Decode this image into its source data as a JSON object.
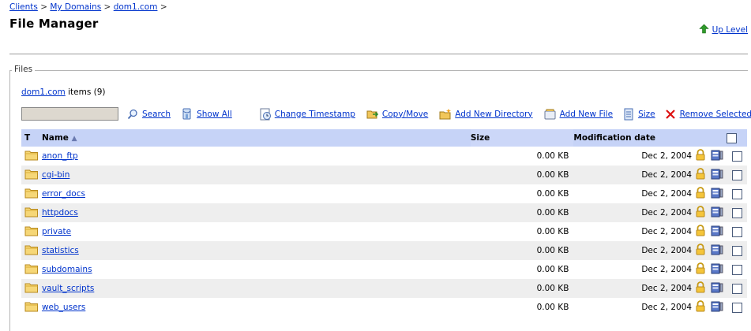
{
  "breadcrumb": {
    "items": [
      "Clients",
      "My Domains",
      "dom1.com"
    ],
    "separator": ">"
  },
  "page": {
    "title": "File Manager",
    "up_level_label": "Up Level"
  },
  "files": {
    "section_label": "Files",
    "domain_link": "dom1.com",
    "items_text": "items (9)"
  },
  "toolbar": {
    "search_value": "",
    "search_label": "Search",
    "show_all_label": "Show All",
    "change_timestamp_label": "Change Timestamp",
    "copy_move_label": "Copy/Move",
    "add_new_directory_label": "Add New Directory",
    "add_new_file_label": "Add New File",
    "size_label": "Size",
    "remove_selected_label": "Remove Selected"
  },
  "table": {
    "columns": {
      "type": "T",
      "name": "Name",
      "name_sort_indicator": "▲",
      "size": "Size",
      "modified": "Modification date"
    },
    "rows": [
      {
        "name": "anon_ftp",
        "size": "0.00 KB",
        "date": "Dec 2, 2004"
      },
      {
        "name": "cgi-bin",
        "size": "0.00 KB",
        "date": "Dec 2, 2004"
      },
      {
        "name": "error_docs",
        "size": "0.00 KB",
        "date": "Dec 2, 2004"
      },
      {
        "name": "httpdocs",
        "size": "0.00 KB",
        "date": "Dec 2, 2004"
      },
      {
        "name": "private",
        "size": "0.00 KB",
        "date": "Dec 2, 2004"
      },
      {
        "name": "statistics",
        "size": "0.00 KB",
        "date": "Dec 2, 2004"
      },
      {
        "name": "subdomains",
        "size": "0.00 KB",
        "date": "Dec 2, 2004"
      },
      {
        "name": "vault_scripts",
        "size": "0.00 KB",
        "date": "Dec 2, 2004"
      },
      {
        "name": "web_users",
        "size": "0.00 KB",
        "date": "Dec 2, 2004"
      }
    ]
  },
  "colors": {
    "link": "#0033cc",
    "header_bg": "#c6d3f7",
    "alt_row_bg": "#eeeeee",
    "folder": "#f2c94c",
    "remove_x": "#d11"
  },
  "icons": {
    "up_level": "green-up-arrow-icon",
    "search": "magnifier-icon",
    "show_all": "show-all-icon",
    "change_timestamp": "timestamp-icon",
    "copy_move": "copy-move-icon",
    "add_directory": "new-folder-icon",
    "add_file": "new-file-icon",
    "size": "size-icon",
    "remove": "red-x-icon",
    "row_folder": "folder-icon",
    "row_permissions": "lock-icon",
    "row_edit": "edit-icon"
  }
}
